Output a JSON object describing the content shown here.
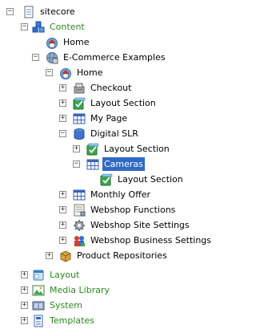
{
  "tree": {
    "nodes": [
      {
        "id": "sitecore",
        "label": "sitecore",
        "icon": "document-icon",
        "expander": "minus",
        "style": "normal"
      },
      {
        "id": "content",
        "label": "Content",
        "icon": "content-cubes-icon",
        "expander": "minus",
        "style": "green"
      },
      {
        "id": "home-1",
        "label": "Home",
        "icon": "home-icon",
        "expander": "",
        "style": "normal"
      },
      {
        "id": "ecommerce-examples",
        "label": "E-Commerce Examples",
        "icon": "globe-icon",
        "expander": "minus",
        "style": "normal"
      },
      {
        "id": "home-2",
        "label": "Home",
        "icon": "home-icon",
        "expander": "minus",
        "style": "normal"
      },
      {
        "id": "checkout",
        "label": "Checkout",
        "icon": "checkout-icon",
        "expander": "plus",
        "style": "normal"
      },
      {
        "id": "layout-section-1",
        "label": "Layout Section",
        "icon": "layout-section-icon",
        "expander": "plus",
        "style": "normal"
      },
      {
        "id": "my-page",
        "label": "My Page",
        "icon": "grid-icon",
        "expander": "plus",
        "style": "normal"
      },
      {
        "id": "digital-slr",
        "label": "Digital SLR",
        "icon": "cylinder-icon",
        "expander": "minus",
        "style": "normal"
      },
      {
        "id": "layout-section-2",
        "label": "Layout Section",
        "icon": "layout-section-icon",
        "expander": "plus",
        "style": "normal"
      },
      {
        "id": "cameras",
        "label": "Cameras",
        "icon": "grid-icon",
        "expander": "minus",
        "style": "selected"
      },
      {
        "id": "layout-section-3",
        "label": "Layout Section",
        "icon": "layout-section-icon",
        "expander": "",
        "style": "normal"
      },
      {
        "id": "monthly-offer",
        "label": "Monthly Offer",
        "icon": "grid-icon",
        "expander": "plus",
        "style": "normal"
      },
      {
        "id": "webshop-functions",
        "label": "Webshop Functions",
        "icon": "functions-icon",
        "expander": "plus",
        "style": "normal"
      },
      {
        "id": "webshop-site-settings",
        "label": "Webshop Site Settings",
        "icon": "settings-gear-icon",
        "expander": "plus",
        "style": "normal"
      },
      {
        "id": "webshop-business-settings",
        "label": "Webshop Business Settings",
        "icon": "business-settings-icon",
        "expander": "plus",
        "style": "normal"
      },
      {
        "id": "product-repositories",
        "label": "Product Repositories",
        "icon": "box-icon",
        "expander": "plus",
        "style": "normal"
      },
      {
        "id": "layout",
        "label": "Layout",
        "icon": "layout-window-icon",
        "expander": "plus",
        "style": "green"
      },
      {
        "id": "media-library",
        "label": "Media Library",
        "icon": "image-icon",
        "expander": "plus",
        "style": "green"
      },
      {
        "id": "system",
        "label": "System",
        "icon": "system-icon",
        "expander": "plus",
        "style": "green"
      },
      {
        "id": "templates",
        "label": "Templates",
        "icon": "templates-icon",
        "expander": "plus",
        "style": "green"
      }
    ]
  },
  "colors": {
    "green_text": "#2b8a1e",
    "selected_background": "#316ac5",
    "selected_text": "#ffffff"
  }
}
